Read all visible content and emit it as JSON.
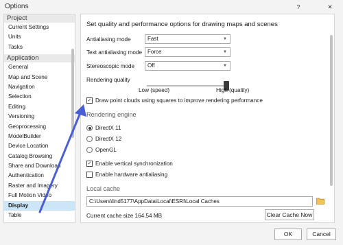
{
  "window": {
    "title": "Options",
    "help_symbol": "?",
    "close_symbol": "✕"
  },
  "sidebar": {
    "section_project": "Project",
    "project_items": [
      "Current Settings",
      "Units",
      "Tasks"
    ],
    "section_application": "Application",
    "application_items": [
      "General",
      "Map and Scene",
      "Navigation",
      "Selection",
      "Editing",
      "Versioning",
      "Geoprocessing",
      "ModelBuilder",
      "Device Location",
      "Catalog Browsing",
      "Share and Download",
      "Authentication",
      "Raster and Imagery",
      "Full Motion Video",
      "Display",
      "Table"
    ],
    "selected": "Display"
  },
  "content": {
    "heading": "Set quality and performance options for drawing maps and scenes",
    "antialiasing_label": "Antialiasing mode",
    "antialiasing_value": "Fast",
    "text_antialiasing_label": "Text antialiasing mode",
    "text_antialiasing_value": "Force",
    "stereoscopic_label": "Stereoscopic mode",
    "stereoscopic_value": "Off",
    "rendering_quality_label": "Rendering quality",
    "rendering_quality_level": 1.0,
    "slider_low": "Low (speed)",
    "slider_high": "High (quality)",
    "point_clouds_label": "Draw point clouds using squares to improve rendering performance",
    "point_clouds_checked": true,
    "rendering_engine_heading": "Rendering engine",
    "engines": [
      "DirectX 11",
      "DirectX 12",
      "OpenGL"
    ],
    "engine_selected": "DirectX 11",
    "vsync_label": "Enable vertical synchronization",
    "vsync_checked": true,
    "hw_aa_label": "Enable hardware antialiasing",
    "hw_aa_checked": false,
    "local_cache_heading": "Local cache",
    "cache_path": "C:\\Users\\lind5177\\AppData\\Local\\ESRI\\Local Caches",
    "cache_size": "Current cache size 164.54 MB",
    "clear_cache_button": "Clear Cache Now"
  },
  "footer": {
    "ok": "OK",
    "cancel": "Cancel"
  },
  "colors": {
    "selection": "#cde6f7",
    "annotation_arrow": "#4a5fd6"
  }
}
